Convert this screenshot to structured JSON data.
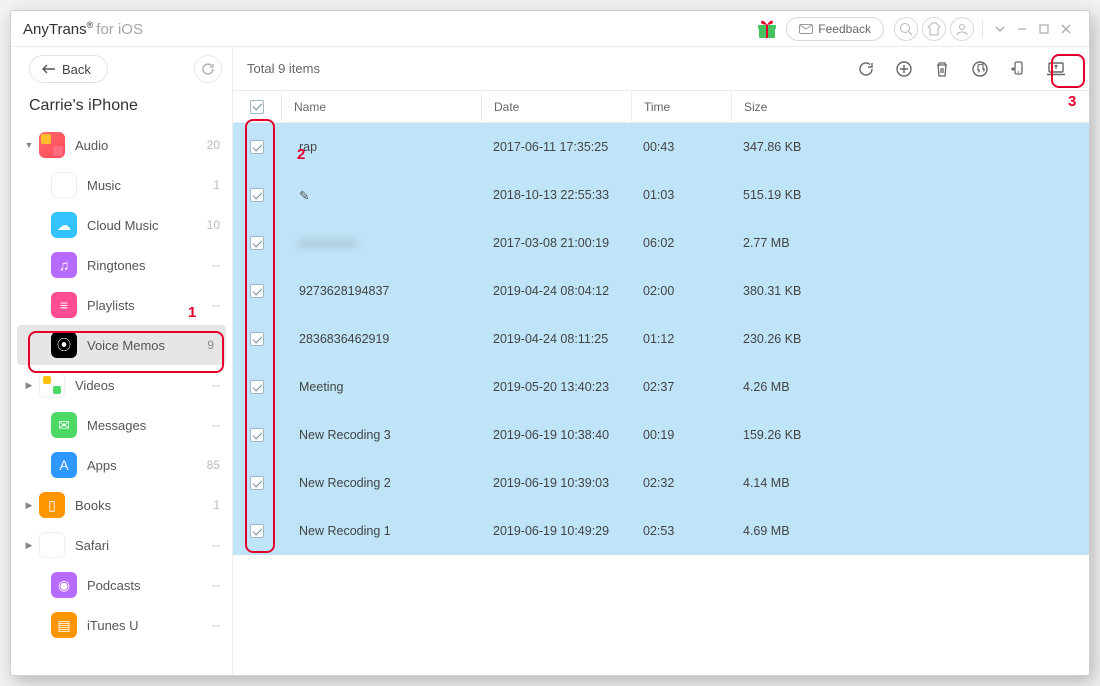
{
  "app": {
    "name": "AnyTrans",
    "sup": "®",
    "sub": "for iOS",
    "feedback": "Feedback"
  },
  "sidebar": {
    "back": "Back",
    "device": "Carrie's iPhone",
    "items": [
      {
        "label": "Audio",
        "count": "20",
        "top": true,
        "ico": "ic-audio",
        "expanded": true
      },
      {
        "label": "Music",
        "count": "1",
        "ico": "ic-music",
        "glyph": "♪"
      },
      {
        "label": "Cloud Music",
        "count": "10",
        "ico": "ic-cloud",
        "glyph": "☁"
      },
      {
        "label": "Ringtones",
        "count": "--",
        "ico": "ic-ring",
        "glyph": "♫"
      },
      {
        "label": "Playlists",
        "count": "--",
        "ico": "ic-play",
        "glyph": "≡"
      },
      {
        "label": "Voice Memos",
        "count": "9",
        "ico": "ic-voice",
        "glyph": "⦿",
        "selected": true
      },
      {
        "label": "Videos",
        "count": "--",
        "top": true,
        "ico": "ic-video"
      },
      {
        "label": "Messages",
        "count": "--",
        "ico": "ic-msg",
        "glyph": "✉"
      },
      {
        "label": "Apps",
        "count": "85",
        "ico": "ic-apps",
        "glyph": "A"
      },
      {
        "label": "Books",
        "count": "1",
        "top": true,
        "ico": "ic-books",
        "glyph": "▯"
      },
      {
        "label": "Safari",
        "count": "--",
        "top": true,
        "ico": "ic-safari",
        "glyph": "◎"
      },
      {
        "label": "Podcasts",
        "count": "--",
        "ico": "ic-pod",
        "glyph": "◉"
      },
      {
        "label": "iTunes U",
        "count": "--",
        "ico": "ic-itunes",
        "glyph": "▤"
      }
    ]
  },
  "toolbar": {
    "total": "Total 9 items"
  },
  "columns": {
    "name": "Name",
    "date": "Date",
    "time": "Time",
    "size": "Size"
  },
  "rows": [
    {
      "name": "rap",
      "date": "2017-06-11 17:35:25",
      "time": "00:43",
      "size": "347.86 KB"
    },
    {
      "name": "",
      "pencil": true,
      "date": "2018-10-13 22:55:33",
      "time": "01:03",
      "size": "515.19 KB"
    },
    {
      "name": "xxxxxxxx",
      "blur": true,
      "date": "2017-03-08 21:00:19",
      "time": "06:02",
      "size": "2.77 MB"
    },
    {
      "name": "9273628194837",
      "date": "2019-04-24 08:04:12",
      "time": "02:00",
      "size": "380.31 KB"
    },
    {
      "name": "2836836462919",
      "date": "2019-04-24 08:11:25",
      "time": "01:12",
      "size": "230.26 KB"
    },
    {
      "name": "Meeting",
      "date": "2019-05-20 13:40:23",
      "time": "02:37",
      "size": "4.26 MB"
    },
    {
      "name": "New Recoding 3",
      "date": "2019-06-19 10:38:40",
      "time": "00:19",
      "size": "159.26 KB"
    },
    {
      "name": "New Recoding 2",
      "date": "2019-06-19 10:39:03",
      "time": "02:32",
      "size": "4.14 MB"
    },
    {
      "name": "New Recoding 1",
      "date": "2019-06-19 10:49:29",
      "time": "02:53",
      "size": "4.69 MB"
    }
  ],
  "anno": {
    "n1": "1",
    "n2": "2",
    "n3": "3"
  }
}
